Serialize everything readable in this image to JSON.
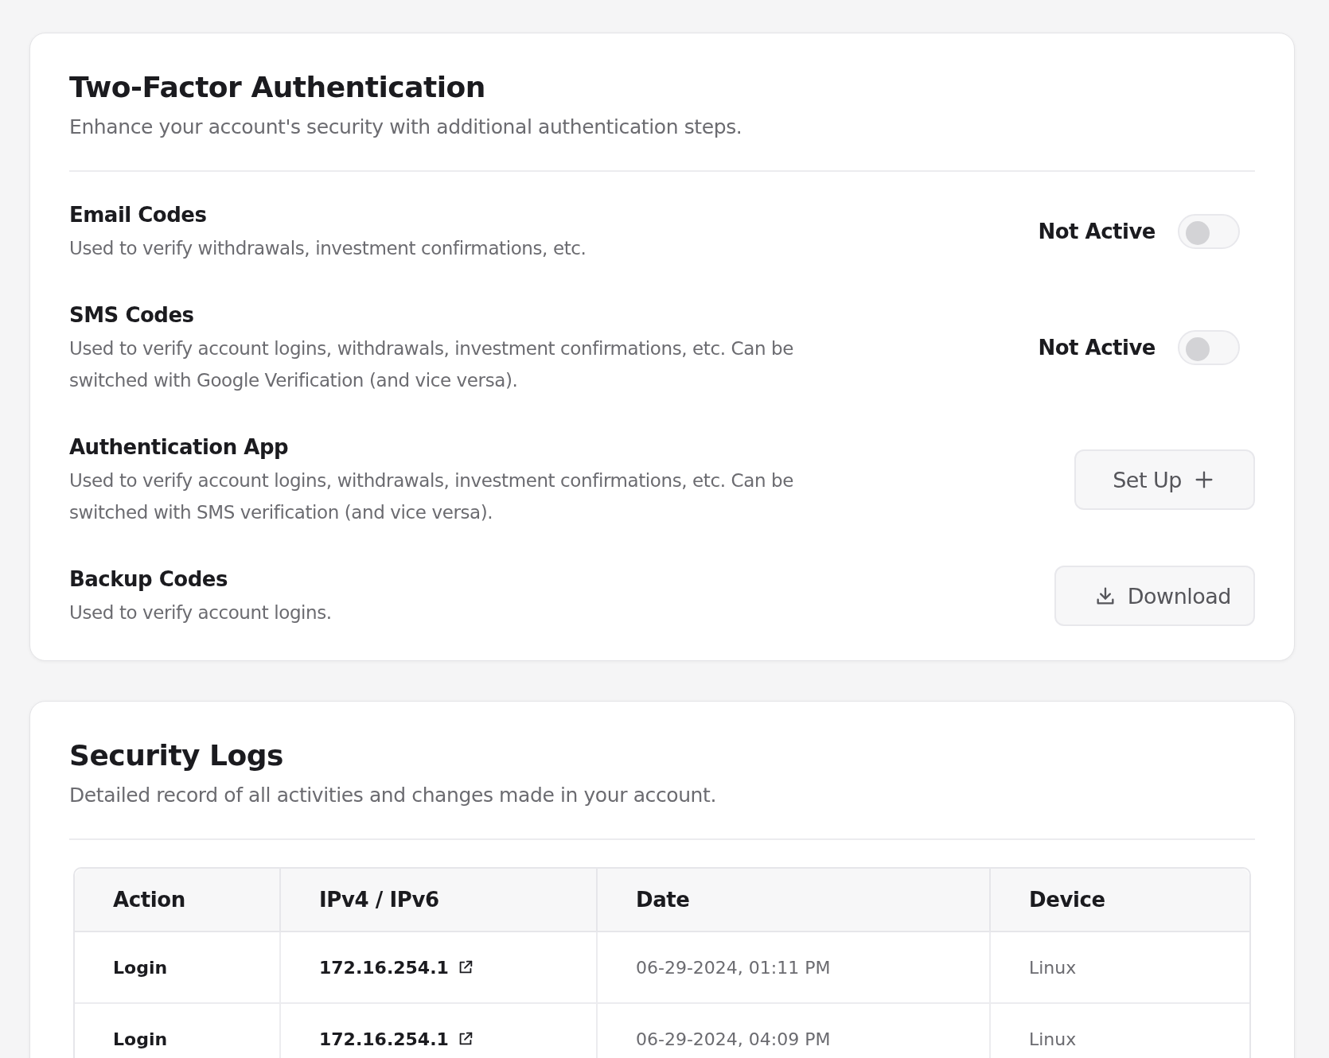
{
  "two_factor": {
    "title": "Two-Factor Authentication",
    "subtitle": "Enhance your account's security with additional authentication steps.",
    "methods": [
      {
        "kind": "toggle",
        "name": "Email Codes",
        "description": "Used to verify withdrawals, investment confirmations, etc.",
        "status": "Not Active",
        "on": false
      },
      {
        "kind": "toggle",
        "name": "SMS Codes",
        "description": "Used to verify account logins, withdrawals, investment confirmations, etc. Can be switched with Google Verification (and vice versa).",
        "status": "Not Active",
        "on": false
      },
      {
        "kind": "add",
        "name": "Authentication App",
        "description": "Used to verify account logins, withdrawals, investment confirmations, etc. Can be switched with SMS verification (and vice versa).",
        "button": "Set Up"
      },
      {
        "kind": "download",
        "name": "Backup Codes",
        "description": "Used to verify account logins.",
        "button": "Download"
      }
    ]
  },
  "security_logs": {
    "title": "Security Logs",
    "subtitle": "Detailed record of all activities and changes made in your account.",
    "table": {
      "columns": [
        "Action",
        "IPv4 / IPv6",
        "Date",
        "Device"
      ],
      "rows": [
        {
          "action": "Login",
          "ip": "172.16.254.1",
          "date": "06-29-2024, 01:11 PM",
          "device": "Linux"
        },
        {
          "action": "Login",
          "ip": "172.16.254.1",
          "date": "06-29-2024, 04:09 PM",
          "device": "Linux"
        }
      ]
    }
  }
}
